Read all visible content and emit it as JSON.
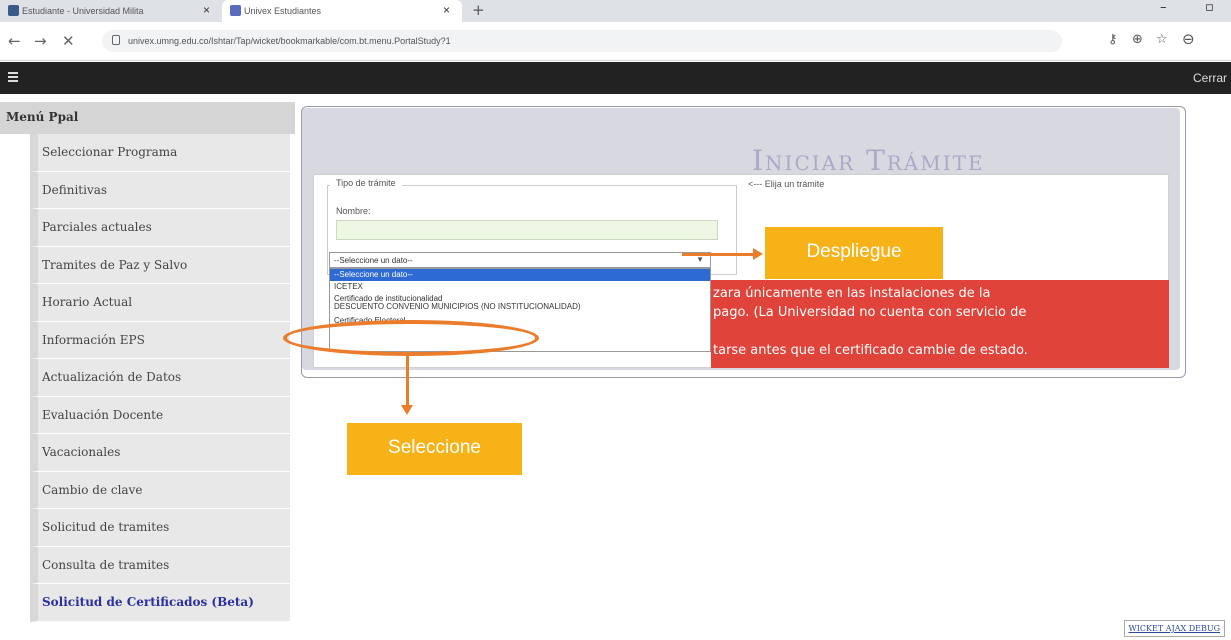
{
  "browser": {
    "tabs": [
      {
        "label": "Estudiante - Universidad Milita"
      },
      {
        "label": "Univex Estudiantes"
      }
    ],
    "url": "univex.umng.edu.co/Ishtar/Tap/wicket/bookmarkable/com.bt.menu.PortalStudy?1"
  },
  "header": {
    "cerrar": "Cerrar"
  },
  "sidebar": {
    "title": "Menú Ppal",
    "items": [
      {
        "label": "Seleccionar Programa"
      },
      {
        "label": "Definitivas"
      },
      {
        "label": "Parciales actuales"
      },
      {
        "label": "Tramites de Paz y Salvo"
      },
      {
        "label": "Horario Actual"
      },
      {
        "label": "Información EPS"
      },
      {
        "label": "Actualización de Datos"
      },
      {
        "label": "Evaluación Docente"
      },
      {
        "label": "Vacacionales"
      },
      {
        "label": "Cambio de clave"
      },
      {
        "label": "Solicitud de tramites"
      },
      {
        "label": "Consulta de tramites"
      },
      {
        "label": "Solicitud de Certificados (Beta)"
      }
    ]
  },
  "main": {
    "title": "Iniciar Trámite",
    "legend": "Tipo de trámite",
    "nombre_label": "Nombre:",
    "hint": "<--- Elija un trámite",
    "select_value": "--Seleccione un dato--",
    "options": [
      "--Seleccione un dato--",
      "ICETEX",
      "Certificado de institucionalidad",
      "DESCUENTO CONVENIO MUNICIPIOS (NO INSTITUCIONALIDAD)",
      "Certificado Electoral"
    ],
    "alert_lines": [
      "zara únicamente en las instalaciones de la",
      "pago. (La Universidad no cuenta con servicio de",
      "",
      "tarse antes que el certificado cambie de estado."
    ]
  },
  "annotations": {
    "despliegue": "Despliegue",
    "seleccione": "Seleccione"
  },
  "footer": {
    "debug": "WICKET AJAX DEBUG"
  },
  "colors": {
    "accent": "#f7b217",
    "annotation_stroke": "#ea7c2c",
    "alert": "#e0433a",
    "app_header": "#222222"
  }
}
